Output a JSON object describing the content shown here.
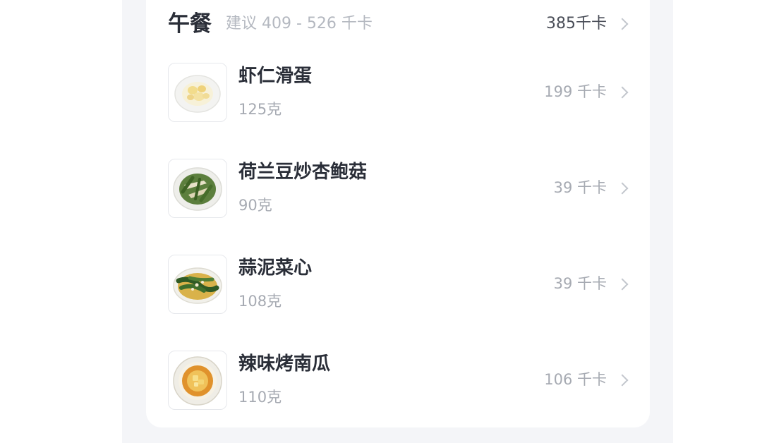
{
  "meal": {
    "title": "午餐",
    "suggestion": "建议 409 - 526 千卡",
    "total": "385千卡"
  },
  "foods": [
    {
      "name": "虾仁滑蛋",
      "weight": "125克",
      "kcal": "199 千卡",
      "icon": "shrimp-egg-dish-icon"
    },
    {
      "name": "荷兰豆炒杏鲍菇",
      "weight": "90克",
      "kcal": "39 千卡",
      "icon": "snow-pea-mushroom-dish-icon"
    },
    {
      "name": "蒜泥菜心",
      "weight": "108克",
      "kcal": "39 千卡",
      "icon": "garlic-greens-dish-icon"
    },
    {
      "name": "辣味烤南瓜",
      "weight": "110克",
      "kcal": "106 千卡",
      "icon": "spicy-pumpkin-dish-icon"
    }
  ]
}
